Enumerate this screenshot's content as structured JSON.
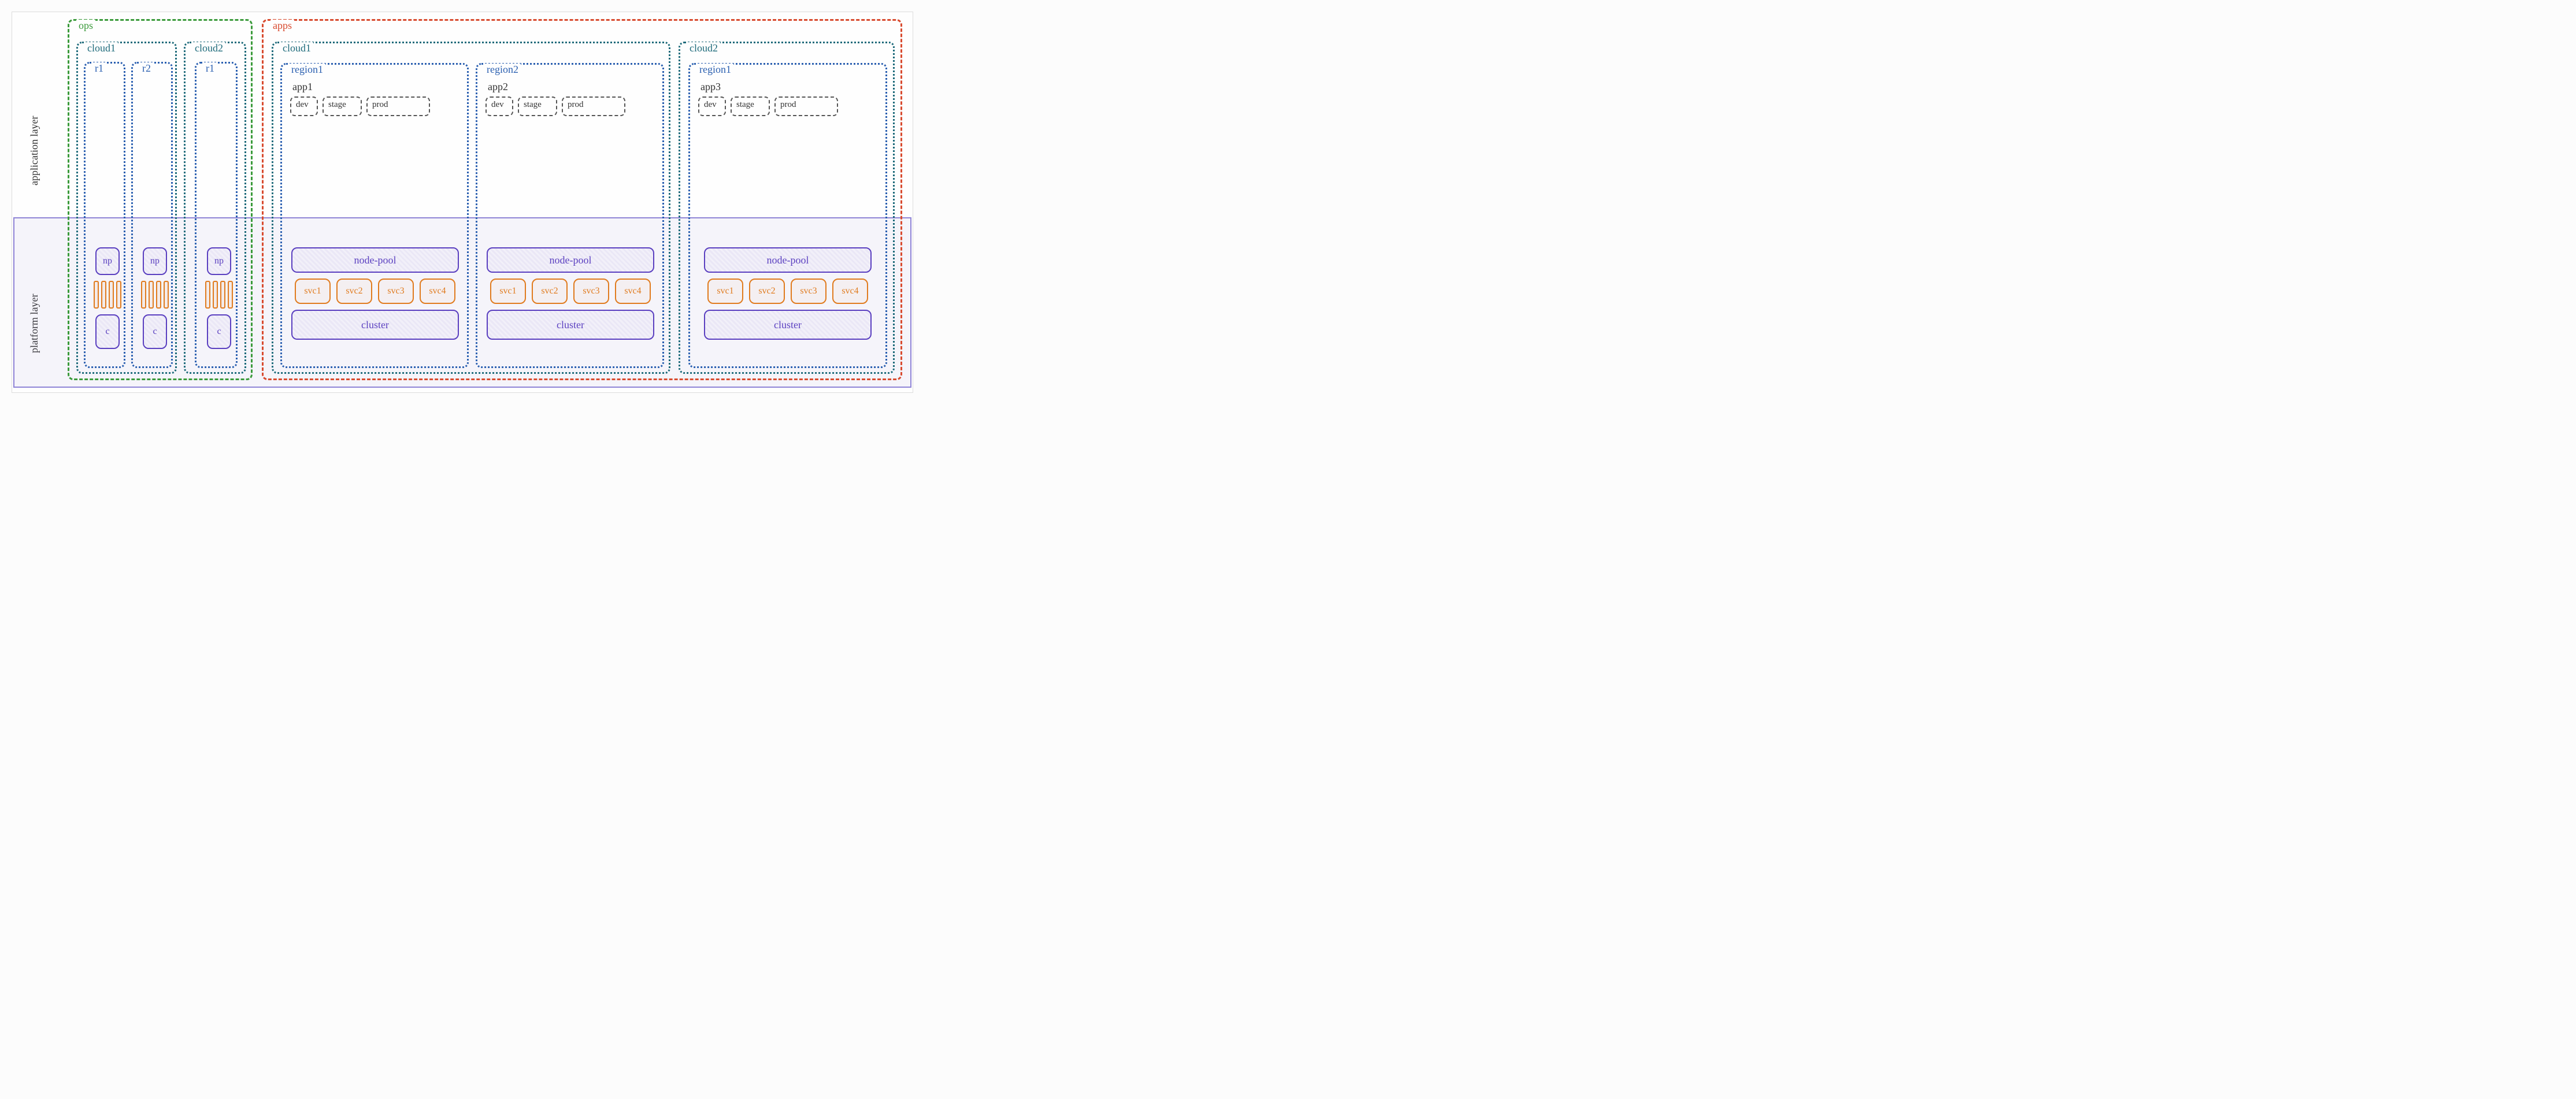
{
  "layers": {
    "application": "application layer",
    "platform": "platform layer"
  },
  "ops": {
    "label": "ops",
    "clouds": [
      {
        "label": "cloud1",
        "regions": [
          {
            "label": "r1",
            "np": "np",
            "cluster": "c"
          },
          {
            "label": "r2",
            "np": "np",
            "cluster": "c"
          }
        ]
      },
      {
        "label": "cloud2",
        "regions": [
          {
            "label": "r1",
            "np": "np",
            "cluster": "c"
          }
        ]
      }
    ]
  },
  "apps": {
    "label": "apps",
    "clouds": [
      {
        "label": "cloud1",
        "regions": [
          {
            "label": "region1",
            "app": "app1",
            "envs": [
              "dev",
              "stage",
              "prod"
            ],
            "pool": "node-pool",
            "svcs": [
              "svc1",
              "svc2",
              "svc3",
              "svc4"
            ],
            "cluster": "cluster"
          },
          {
            "label": "region2",
            "app": "app2",
            "envs": [
              "dev",
              "stage",
              "prod"
            ],
            "pool": "node-pool",
            "svcs": [
              "svc1",
              "svc2",
              "svc3",
              "svc4"
            ],
            "cluster": "cluster"
          }
        ]
      },
      {
        "label": "cloud2",
        "regions": [
          {
            "label": "region1",
            "app": "app3",
            "envs": [
              "dev",
              "stage",
              "prod"
            ],
            "pool": "node-pool",
            "svcs": [
              "svc1",
              "svc2",
              "svc3",
              "svc4"
            ],
            "cluster": "cluster"
          }
        ]
      }
    ]
  }
}
